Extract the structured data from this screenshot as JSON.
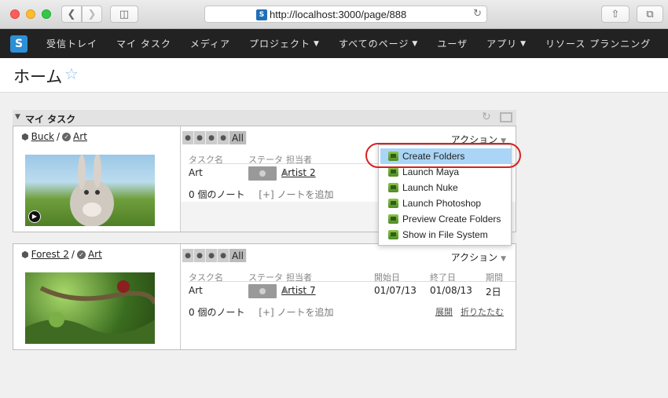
{
  "browser": {
    "url": "http://localhost:3000/page/888"
  },
  "nav": {
    "logo": "S",
    "items": [
      {
        "label": "受信トレイ",
        "caret": false
      },
      {
        "label": "マイ タスク",
        "caret": false
      },
      {
        "label": "メディア",
        "caret": false
      },
      {
        "label": "プロジェクト",
        "caret": true
      },
      {
        "label": "すべてのページ",
        "caret": true
      },
      {
        "label": "ユーザ",
        "caret": false
      },
      {
        "label": "アプリ",
        "caret": true
      },
      {
        "label": "リソース プランニング",
        "caret": false
      }
    ]
  },
  "page": {
    "title": "ホーム"
  },
  "widget": {
    "title": "マイ タスク",
    "columns": {
      "task": "タスク名",
      "status": "ステータ",
      "assignee": "担当者",
      "start": "開始日",
      "end": "終了日",
      "duration": "期間"
    },
    "cards": [
      {
        "entity": "Buck",
        "separator": "/",
        "step": "Art",
        "pager_all": "All",
        "action": "アクション",
        "task": {
          "name": "Art",
          "assignee": "Artist 2"
        },
        "notes": "0 個のノート",
        "add_note": "[+] ノートを追加"
      },
      {
        "entity": "Forest 2",
        "separator": "/",
        "step": "Art",
        "pager_all": "All",
        "action": "アクション",
        "task": {
          "name": "Art",
          "assignee": "Artist 7",
          "start": "01/07/13",
          "end": "01/08/13",
          "duration": "2日"
        },
        "notes": "0 個のノート",
        "add_note": "[+] ノートを追加",
        "expand": "展開",
        "collapse": "折りたたむ"
      }
    ]
  },
  "action_menu": {
    "items": [
      "Create Folders",
      "Launch Maya",
      "Launch Nuke",
      "Launch Photoshop",
      "Preview Create Folders",
      "Show in File System"
    ],
    "active_index": 0
  },
  "colors": {
    "nav_bg": "#222222",
    "menu_highlight": "#aad5f6",
    "annotation_ring": "#d92020"
  }
}
